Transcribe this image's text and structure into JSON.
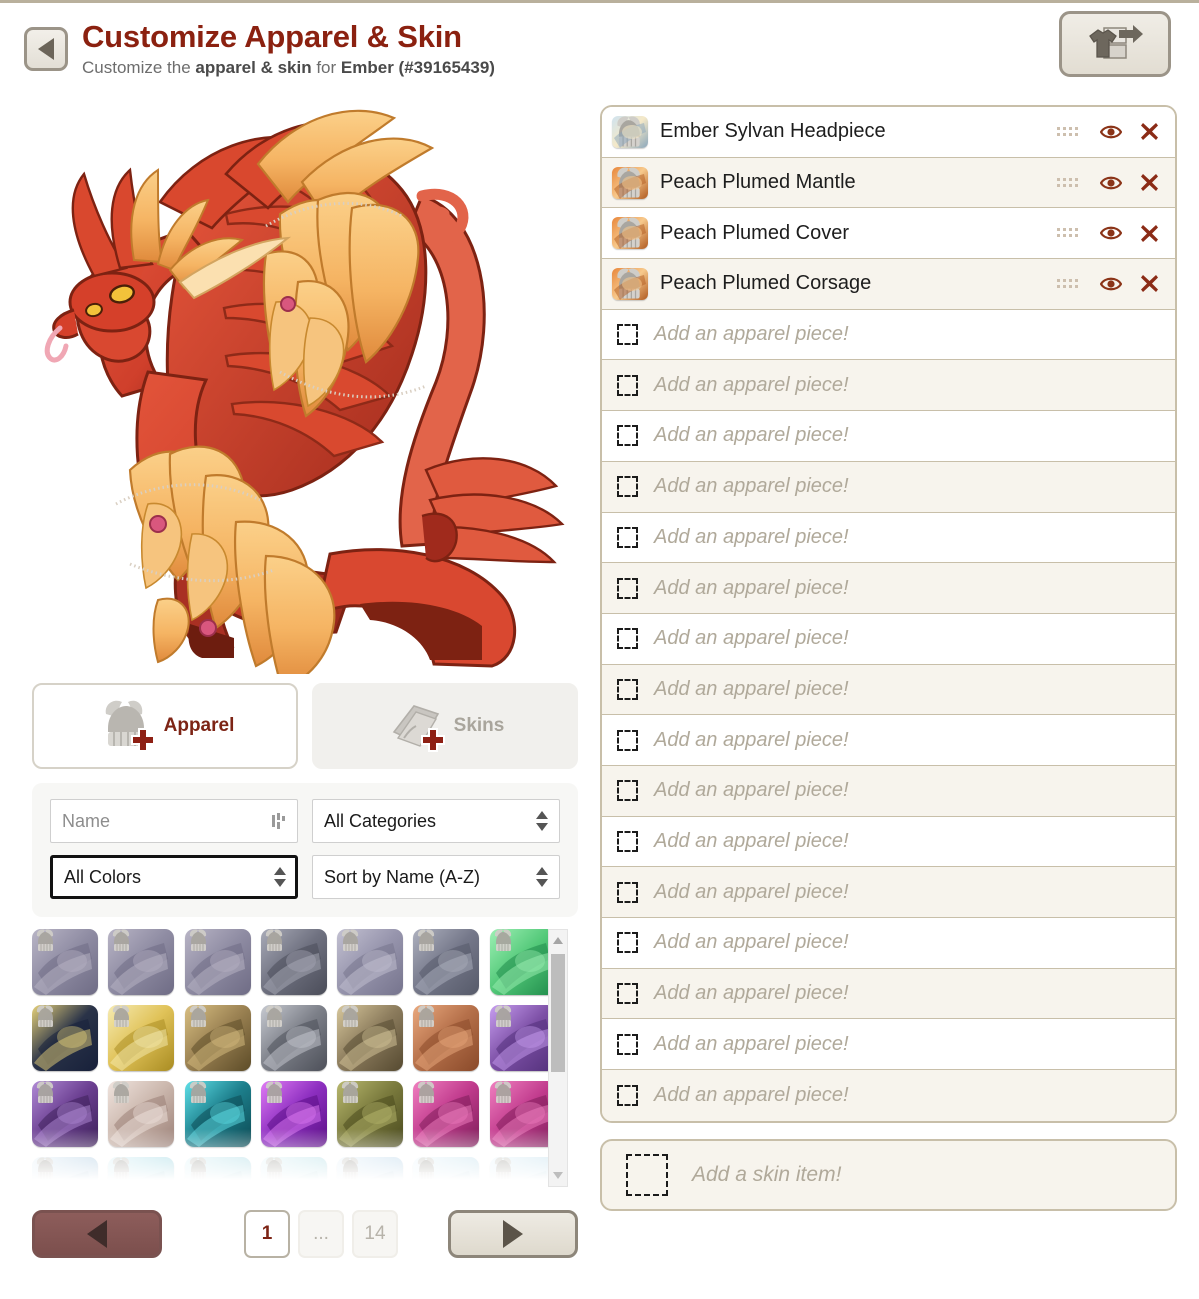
{
  "header": {
    "back_label": "Back",
    "title": "Customize Apparel & Skin",
    "subtitle_pre": "Customize the ",
    "subtitle_bold1": "apparel & skin",
    "subtitle_mid": " for ",
    "subtitle_bold2": "Ember (#39165439)",
    "transfer_button_label": "Transfer apparel",
    "title_color": "#8b2110"
  },
  "preview": {
    "dragon_name": "Ember",
    "dragon_id": "#39165439",
    "alt": "Red and peach feathered dragon wearing peach plumed apparel"
  },
  "tabs": [
    {
      "id": "apparel",
      "label": "Apparel",
      "icon": "helmet-plus-icon",
      "active": true
    },
    {
      "id": "skins",
      "label": "Skins",
      "icon": "skin-plus-icon",
      "active": false
    }
  ],
  "filters": {
    "name": {
      "label": "Name",
      "value": "",
      "placeholder": "Name",
      "icon": "name-filter-icon"
    },
    "category": {
      "value": "All Categories",
      "icon": "select-arrows-icon"
    },
    "color": {
      "value": "All Colors",
      "icon": "select-arrows-icon",
      "focused": true
    },
    "sort": {
      "value": "Sort by Name (A-Z)",
      "icon": "select-arrows-icon"
    }
  },
  "item_grid": {
    "columns": 7,
    "scrollbar": {
      "up_icon": "scroll-up-arrow-icon",
      "down_icon": "scroll-down-arrow-icon"
    },
    "items": [
      {
        "c1": "#8f8ca3",
        "c2": "#b9b5c6",
        "c3": "#6f6c85"
      },
      {
        "c1": "#8f8ca3",
        "c2": "#b9b5c6",
        "c3": "#6f6c85"
      },
      {
        "c1": "#8f8ca3",
        "c2": "#b9b5c6",
        "c3": "#6f6c85"
      },
      {
        "c1": "#6f7180",
        "c2": "#a9abb8",
        "c3": "#4b4d59"
      },
      {
        "c1": "#9795ad",
        "c2": "#c3c1d2",
        "c3": "#76748d"
      },
      {
        "c1": "#75788a",
        "c2": "#aeb1bf",
        "c3": "#565a69"
      },
      {
        "c1": "#52c878",
        "c2": "#9df0b4",
        "c3": "#1f8a4a"
      },
      {
        "c1": "#2a3348",
        "c2": "#e7d27a",
        "c3": "#17203a"
      },
      {
        "c1": "#e0c258",
        "c2": "#f6ebb2",
        "c3": "#a98c22"
      },
      {
        "c1": "#9a8152",
        "c2": "#d9bf82",
        "c3": "#5d4c28"
      },
      {
        "c1": "#7d8089",
        "c2": "#c7cad1",
        "c3": "#4d5059"
      },
      {
        "c1": "#8c7c5d",
        "c2": "#d7c79c",
        "c3": "#564a31"
      },
      {
        "c1": "#b5704a",
        "c2": "#eaa97e",
        "c3": "#8a4a2a"
      },
      {
        "c1": "#7c4fa5",
        "c2": "#c79ef0",
        "c3": "#52307a"
      },
      {
        "c1": "#6b3f91",
        "c2": "#b18bd6",
        "c3": "#3e2159"
      },
      {
        "c1": "#cbb7ad",
        "c2": "#f0e4de",
        "c3": "#9b8077"
      },
      {
        "c1": "#1d7f8c",
        "c2": "#5fe0e8",
        "c3": "#0c4a54"
      },
      {
        "c1": "#8d2fc0",
        "c2": "#e07cf5",
        "c3": "#5b0f85"
      },
      {
        "c1": "#7a7a3d",
        "c2": "#b8b86e",
        "c3": "#4a4a1e"
      },
      {
        "c1": "#c13b8d",
        "c2": "#f080c0",
        "c3": "#7d1e59"
      },
      {
        "c1": "#c13b8d",
        "c2": "#f080c0",
        "c3": "#7d1e59"
      },
      {
        "c1": "#b9d3e6",
        "c2": "#eef6fb",
        "c3": "#8aa8c0"
      },
      {
        "c1": "#a9dce6",
        "c2": "#e4f6fa",
        "c3": "#7ab0bd"
      },
      {
        "c1": "#b6e0e8",
        "c2": "#e8f8fb",
        "c3": "#84b9c4"
      },
      {
        "c1": "#bfe4ea",
        "c2": "#edf9fc",
        "c3": "#8cbfc9"
      },
      {
        "c1": "#c3dced",
        "c2": "#eff7fc",
        "c3": "#90b4c8"
      },
      {
        "c1": "#cde6f0",
        "c2": "#f2fafd",
        "c3": "#9cc2d2"
      },
      {
        "c1": "#c7e2ee",
        "c2": "#f0f9fd",
        "c3": "#96bdcd"
      }
    ]
  },
  "pagination": {
    "prev_label": "Previous page",
    "next_label": "Next page",
    "pages": [
      {
        "label": "1",
        "current": true
      },
      {
        "label": "...",
        "current": false
      },
      {
        "label": "14",
        "current": false
      }
    ]
  },
  "apparel_list": {
    "equipped": [
      {
        "name": "Ember Sylvan Headpiece",
        "thumb": {
          "c1": "#cfe3f0",
          "c2": "#f5e9c8",
          "c3": "#8aa6bb"
        },
        "drag_icon": "drag-handle-icon",
        "eye_icon": "eye-icon",
        "remove_icon": "remove-x-icon"
      },
      {
        "name": "Peach Plumed Mantle",
        "thumb": {
          "c1": "#e8863a",
          "c2": "#f7c98c",
          "c3": "#b05a20"
        },
        "drag_icon": "drag-handle-icon",
        "eye_icon": "eye-icon",
        "remove_icon": "remove-x-icon"
      },
      {
        "name": "Peach Plumed Cover",
        "thumb": {
          "c1": "#e8863a",
          "c2": "#f7c98c",
          "c3": "#b05a20"
        },
        "drag_icon": "drag-handle-icon",
        "eye_icon": "eye-icon",
        "remove_icon": "remove-x-icon"
      },
      {
        "name": "Peach Plumed Corsage",
        "thumb": {
          "c1": "#e8863a",
          "c2": "#f7c98c",
          "c3": "#b05a20"
        },
        "drag_icon": "drag-handle-icon",
        "eye_icon": "eye-icon",
        "remove_icon": "remove-x-icon"
      }
    ],
    "empty_slot_label": "Add an apparel piece!",
    "empty_slot_count": 16,
    "empty_slot_icon": "dashed-square-icon"
  },
  "skin_slot": {
    "label": "Add a skin item!",
    "icon": "dashed-square-icon"
  },
  "colors": {
    "accent_red": "#8b2110",
    "panel_border": "#c8bfa9",
    "row_alt": "#f7f4ed",
    "muted_italic": "#b0a99a",
    "eye_icon": "#8b3418",
    "x_icon": "#8b2b16"
  }
}
